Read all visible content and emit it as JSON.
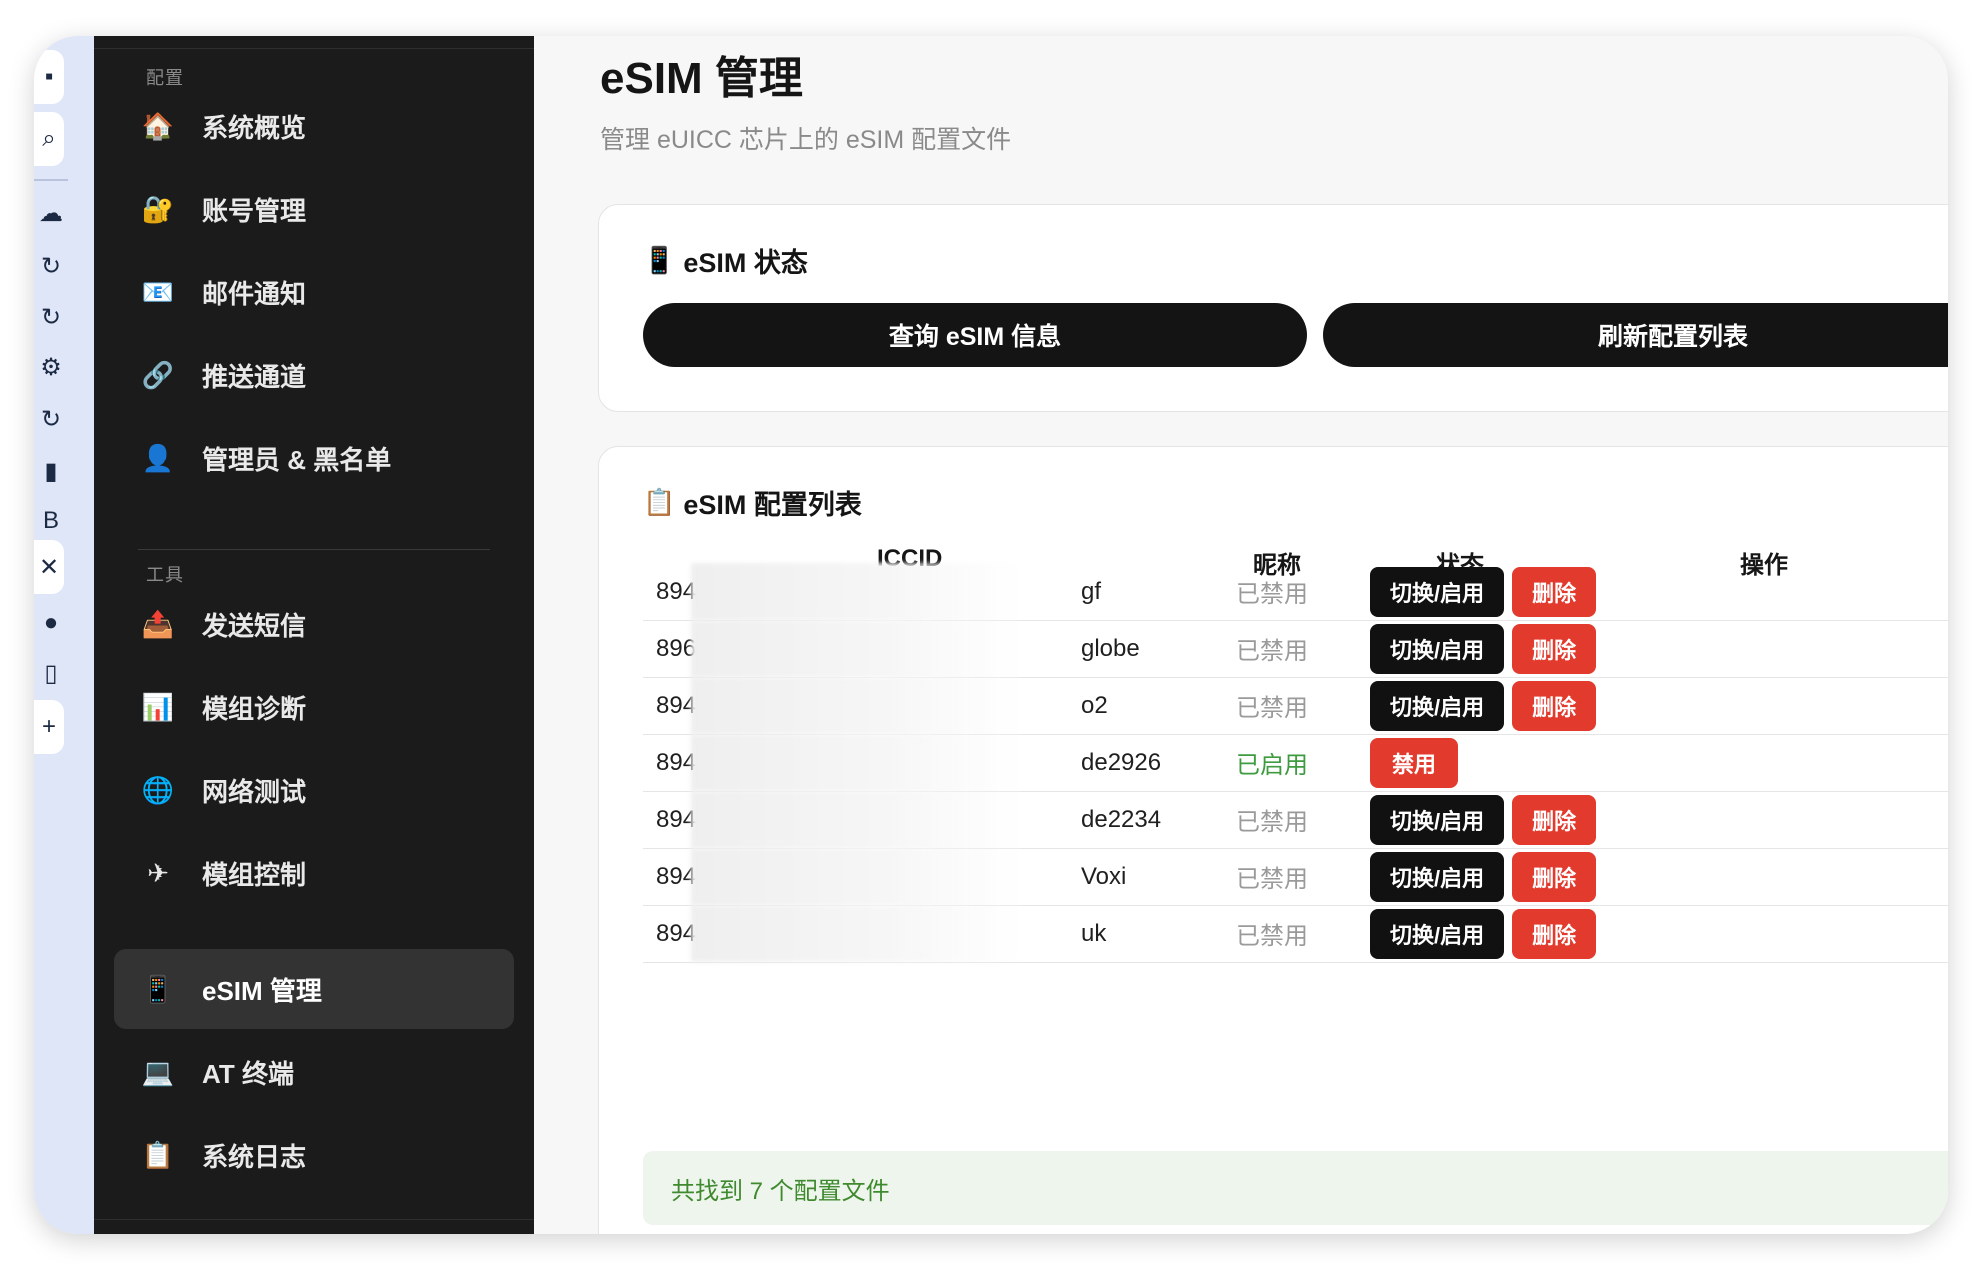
{
  "dock": {
    "items": [
      {
        "icon": "grid-icon",
        "glyph": "▪"
      },
      {
        "icon": "search-icon",
        "glyph": "⌕"
      },
      {
        "icon": "cloud-icon",
        "glyph": "☁"
      },
      {
        "icon": "refresh-icon",
        "glyph": "↻"
      },
      {
        "icon": "refresh-icon",
        "glyph": "↻"
      },
      {
        "icon": "robot-icon",
        "glyph": "⚙"
      },
      {
        "icon": "refresh-icon",
        "glyph": "↻"
      },
      {
        "icon": "terminal-icon",
        "glyph": "▮"
      },
      {
        "icon": "b-icon",
        "glyph": "B"
      },
      {
        "icon": "close-icon",
        "glyph": "✕"
      },
      {
        "icon": "app-icon",
        "glyph": "●"
      },
      {
        "icon": "bottle-icon",
        "glyph": "▯"
      },
      {
        "icon": "plus-icon",
        "glyph": "+"
      }
    ]
  },
  "sidebar": {
    "section_config": "配置",
    "section_tools": "工具",
    "items": [
      {
        "label": "系统概览",
        "icon": "house-icon",
        "glyph": "🏠"
      },
      {
        "label": "账号管理",
        "icon": "lock-icon",
        "glyph": "🔐"
      },
      {
        "label": "邮件通知",
        "icon": "mail-icon",
        "glyph": "📧"
      },
      {
        "label": "推送通道",
        "icon": "link-icon",
        "glyph": "🔗"
      },
      {
        "label": "管理员 & 黑名单",
        "icon": "user-icon",
        "glyph": "👤"
      },
      {
        "label": "发送短信",
        "icon": "outbox-icon",
        "glyph": "📤"
      },
      {
        "label": "模组诊断",
        "icon": "chart-icon",
        "glyph": "📊"
      },
      {
        "label": "网络测试",
        "icon": "globe-icon",
        "glyph": "🌐"
      },
      {
        "label": "模组控制",
        "icon": "airplane-icon",
        "glyph": "✈"
      },
      {
        "label": "eSIM 管理",
        "icon": "phone-icon",
        "glyph": "📱"
      },
      {
        "label": "AT 终端",
        "icon": "laptop-icon",
        "glyph": "💻"
      },
      {
        "label": "系统日志",
        "icon": "clipboard-icon",
        "glyph": "📋"
      }
    ],
    "active": "eSIM 管理"
  },
  "page": {
    "title": "eSIM 管理",
    "subtitle": "管理 eUICC 芯片上的 eSIM 配置文件"
  },
  "status_card": {
    "icon": "phone-icon",
    "glyph": "📱",
    "title": "eSIM 状态",
    "query_button": "查询 eSIM 信息",
    "refresh_button": "刷新配置列表"
  },
  "list_card": {
    "icon": "clipboard-icon",
    "glyph": "📋",
    "title": "eSIM 配置列表",
    "columns": {
      "iccid": "ICCID",
      "nickname": "昵称",
      "status": "状态",
      "actions": "操作"
    },
    "rows": [
      {
        "iccid_prefix": "894",
        "nickname": "gf",
        "status": "已禁用",
        "enabled": false,
        "actions": [
          "切换/启用",
          "删除"
        ]
      },
      {
        "iccid_prefix": "896",
        "nickname": "globe",
        "status": "已禁用",
        "enabled": false,
        "actions": [
          "切换/启用",
          "删除"
        ]
      },
      {
        "iccid_prefix": "894",
        "nickname": "o2",
        "status": "已禁用",
        "enabled": false,
        "actions": [
          "切换/启用",
          "删除"
        ]
      },
      {
        "iccid_prefix": "894",
        "nickname": "de2926",
        "status": "已启用",
        "enabled": true,
        "actions": [
          "禁用"
        ]
      },
      {
        "iccid_prefix": "894",
        "nickname": "de2234",
        "status": "已禁用",
        "enabled": false,
        "actions": [
          "切换/启用",
          "删除"
        ]
      },
      {
        "iccid_prefix": "894",
        "nickname": "Voxi",
        "status": "已禁用",
        "enabled": false,
        "actions": [
          "切换/启用",
          "删除"
        ]
      },
      {
        "iccid_prefix": "894",
        "nickname": "uk",
        "status": "已禁用",
        "enabled": false,
        "actions": [
          "切换/启用",
          "删除"
        ]
      }
    ],
    "found_text": "共找到 7 个配置文件"
  },
  "colors": {
    "sidebar_bg": "#1b1b1b",
    "button_dark": "#141414",
    "button_red": "#e23a2d",
    "status_enabled": "#3f9b3f",
    "status_disabled": "#9a9a9a",
    "found_bg": "#eef5ec"
  }
}
